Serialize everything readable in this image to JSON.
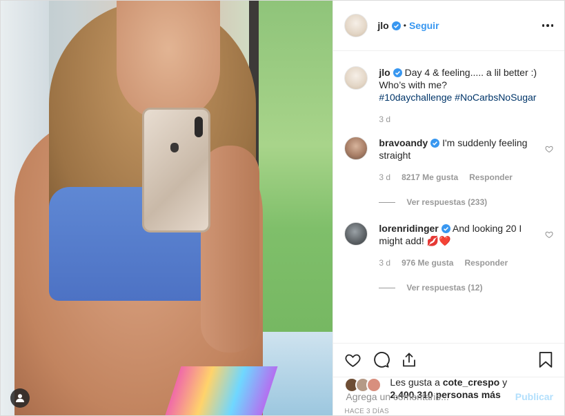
{
  "post": {
    "username": "jlo",
    "follow_label": "Seguir",
    "separator": "•"
  },
  "caption": {
    "username": "jlo",
    "text": "Day 4 & feeling..... a lil better :) Who’s with me?",
    "hashtags": [
      "#10daychallenge",
      "#NoCarbsNoSugar"
    ],
    "time": "3 d"
  },
  "comments": [
    {
      "username": "bravoandy",
      "text": "I'm suddenly feeling straight",
      "time": "3 d",
      "likes": "8217 Me gusta",
      "reply_label": "Responder",
      "view_replies": "Ver respuestas (233)"
    },
    {
      "username": "lorenridinger",
      "text": "And looking 20 I might add! 💋❤️",
      "time": "3 d",
      "likes": "976 Me gusta",
      "reply_label": "Responder",
      "view_replies": "Ver respuestas (12)"
    }
  ],
  "likes_summary": {
    "prefix": "Les gusta a",
    "user": "cote_crespo",
    "connector": "y",
    "count": "2,400,310 personas más"
  },
  "time_ago": "HACE 3 DÍAS",
  "comment_box": {
    "placeholder": "Agrega un comentario...",
    "publish_label": "Publicar"
  },
  "colors": {
    "link": "#3897f0",
    "hashtag": "#003569",
    "muted": "#999999",
    "publish_disabled": "#b2dffc"
  }
}
